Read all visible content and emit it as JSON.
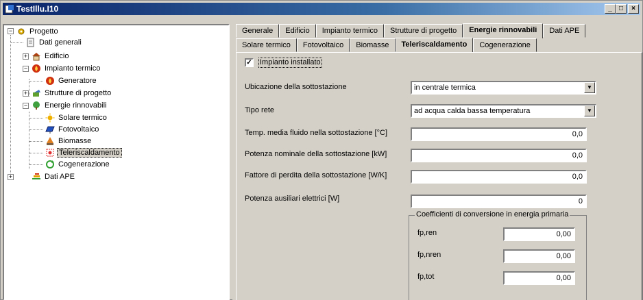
{
  "window": {
    "title": "TestIllu.I10",
    "btn_min": "_",
    "btn_max": "□",
    "btn_close": "×"
  },
  "tree": {
    "items": [
      {
        "label": "Progetto",
        "expander": "−",
        "icon": "sun-gear-icon",
        "color": "#e0b000"
      },
      {
        "label": "Dati generali",
        "icon": "document-icon",
        "color": "#c8c8c8"
      },
      {
        "label": "Edificio",
        "expander": "+",
        "icon": "house-icon",
        "color": "#b06020"
      },
      {
        "label": "Impianto termico",
        "expander": "−",
        "icon": "flame-icon",
        "color": "#e04010"
      },
      {
        "label": "Generatore",
        "icon": "flame-icon",
        "color": "#e04010"
      },
      {
        "label": "Strutture di progetto",
        "expander": "+",
        "icon": "structure-icon",
        "color": "#60a030"
      },
      {
        "label": "Energie rinnovabili",
        "expander": "−",
        "icon": "tree-icon",
        "color": "#40a040"
      },
      {
        "label": "Solare termico",
        "icon": "sun-icon",
        "color": "#f0b000"
      },
      {
        "label": "Fotovoltaico",
        "icon": "solar-panel-icon",
        "color": "#2050c0"
      },
      {
        "label": "Biomasse",
        "icon": "biomass-icon",
        "color": "#c06020"
      },
      {
        "label": "Teleriscaldamento",
        "icon": "district-heating-icon",
        "color": "#e03030"
      },
      {
        "label": "Cogenerazione",
        "icon": "cogeneration-icon",
        "color": "#30a030"
      },
      {
        "label": "Dati APE",
        "expander": "+",
        "icon": "chart-icon",
        "color": "#e0a000"
      }
    ]
  },
  "tabs_top": [
    "Generale",
    "Edificio",
    "Impianto termico",
    "Strutture di progetto",
    "Energie rinnovabili",
    "Dati APE"
  ],
  "tabs_sub": [
    "Solare termico",
    "Fotovoltaico",
    "Biomasse",
    "Teleriscaldamento",
    "Cogenerazione"
  ],
  "form": {
    "installed_label": "Impianto installato",
    "installed_checked": "✓",
    "ubicazione_label": "Ubicazione della sottostazione",
    "ubicazione_value": "in centrale termica",
    "tipo_rete_label": "Tipo rete",
    "tipo_rete_value": "ad acqua calda bassa temperatura",
    "temp_label": "Temp. media fluido nella sottostazione [°C]",
    "temp_value": "0,0",
    "potenza_label": "Potenza nominale della sottostazione [kW]",
    "potenza_value": "0,0",
    "perdita_label": "Fattore di perdita della sottostazione [W/K]",
    "perdita_value": "0,0",
    "ausiliari_label": "Potenza ausiliari elettrici [W]",
    "ausiliari_value": "0",
    "arrow": "▼"
  },
  "coeff": {
    "title": "Coefficienti di conversione in energia primaria",
    "fpren_label": "fp,ren",
    "fpren_value": "0,00",
    "fpnren_label": "fp,nren",
    "fpnren_value": "0,00",
    "fptot_label": "fp,tot",
    "fptot_value": "0,00"
  }
}
